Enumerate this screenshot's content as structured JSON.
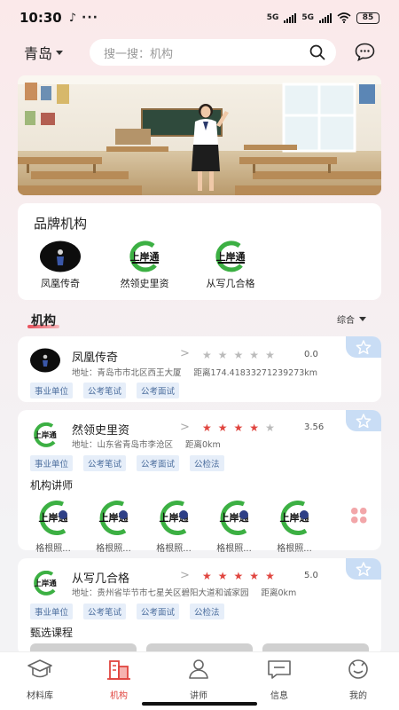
{
  "status": {
    "time": "10:30",
    "network1": "5G",
    "network2": "5G",
    "battery": "85"
  },
  "header": {
    "city": "青岛",
    "search_placeholder": "搜一搜：机构"
  },
  "brands": {
    "title": "品牌机构",
    "items": [
      {
        "name": "凤凰传奇"
      },
      {
        "name": "然领史里资"
      },
      {
        "name": "从写几合格"
      }
    ]
  },
  "section": {
    "title": "机构",
    "sort_label": "综合"
  },
  "orgs": [
    {
      "name": "凤凰传奇",
      "rating": 0,
      "score": "0.0",
      "address": "地址：青岛市市北区西王大厦",
      "distance": "距离174.41833271239273km",
      "tags": [
        "事业单位",
        "公考笔试",
        "公考面试"
      ]
    },
    {
      "name": "然领史里资",
      "rating": 4,
      "score": "3.56",
      "address": "地址：山东省青岛市李沧区",
      "distance": "距离0km",
      "tags": [
        "事业单位",
        "公考笔试",
        "公考面试",
        "公检法"
      ],
      "teachers_title": "机构讲师",
      "teachers": [
        "格根照...",
        "格根照...",
        "格根照...",
        "格根照...",
        "格根照..."
      ]
    },
    {
      "name": "从写几合格",
      "rating": 5,
      "score": "5.0",
      "address": "地址：贵州省毕节市七星关区碧阳大道和诚家园",
      "distance": "距离0km",
      "tags": [
        "事业单位",
        "公考笔试",
        "公考面试",
        "公检法"
      ],
      "courses_title": "甄选课程"
    }
  ],
  "logo_text": "上岸通",
  "tabs": [
    {
      "label": "材料库",
      "icon": "graduation-cap-icon"
    },
    {
      "label": "机构",
      "icon": "building-icon",
      "active": true
    },
    {
      "label": "讲师",
      "icon": "teacher-icon"
    },
    {
      "label": "信息",
      "icon": "message-icon"
    },
    {
      "label": "我的",
      "icon": "profile-icon"
    }
  ],
  "colors": {
    "accent": "#e0453f",
    "tag_bg": "#e6eef9",
    "tag_text": "#4d6f9e",
    "fav_bg": "#c9ddf5"
  }
}
